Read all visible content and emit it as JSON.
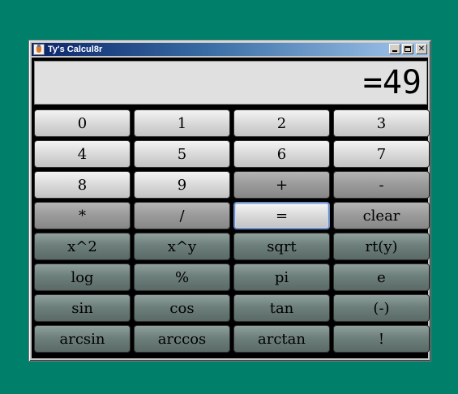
{
  "window": {
    "title": "Ty's Calcul8r"
  },
  "display": {
    "value": "=49"
  },
  "keys": [
    {
      "label": "0",
      "name": "key-0",
      "style": "light"
    },
    {
      "label": "1",
      "name": "key-1",
      "style": "light"
    },
    {
      "label": "2",
      "name": "key-2",
      "style": "light"
    },
    {
      "label": "3",
      "name": "key-3",
      "style": "light"
    },
    {
      "label": "4",
      "name": "key-4",
      "style": "light"
    },
    {
      "label": "5",
      "name": "key-5",
      "style": "light"
    },
    {
      "label": "6",
      "name": "key-6",
      "style": "light"
    },
    {
      "label": "7",
      "name": "key-7",
      "style": "light"
    },
    {
      "label": "8",
      "name": "key-8",
      "style": "light"
    },
    {
      "label": "9",
      "name": "key-9",
      "style": "light"
    },
    {
      "label": "+",
      "name": "key-plus",
      "style": "dark"
    },
    {
      "label": "-",
      "name": "key-minus",
      "style": "dark"
    },
    {
      "label": "*",
      "name": "key-multiply",
      "style": "dark"
    },
    {
      "label": "/",
      "name": "key-divide",
      "style": "dark"
    },
    {
      "label": "=",
      "name": "key-equals",
      "style": "light",
      "focused": true
    },
    {
      "label": "clear",
      "name": "key-clear",
      "style": "dark"
    },
    {
      "label": "x^2",
      "name": "key-square",
      "style": "slate"
    },
    {
      "label": "x^y",
      "name": "key-power",
      "style": "slate"
    },
    {
      "label": "sqrt",
      "name": "key-sqrt",
      "style": "slate"
    },
    {
      "label": "rt(y)",
      "name": "key-root",
      "style": "slate"
    },
    {
      "label": "log",
      "name": "key-log",
      "style": "slate"
    },
    {
      "label": "%",
      "name": "key-percent",
      "style": "slate"
    },
    {
      "label": "pi",
      "name": "key-pi",
      "style": "slate"
    },
    {
      "label": "e",
      "name": "key-e",
      "style": "slate"
    },
    {
      "label": "sin",
      "name": "key-sin",
      "style": "slate"
    },
    {
      "label": "cos",
      "name": "key-cos",
      "style": "slate"
    },
    {
      "label": "tan",
      "name": "key-tan",
      "style": "slate"
    },
    {
      "label": "(-)",
      "name": "key-negate",
      "style": "slate"
    },
    {
      "label": "arcsin",
      "name": "key-arcsin",
      "style": "slate"
    },
    {
      "label": "arccos",
      "name": "key-arccos",
      "style": "slate"
    },
    {
      "label": "arctan",
      "name": "key-arctan",
      "style": "slate"
    },
    {
      "label": "!",
      "name": "key-factorial",
      "style": "slate"
    }
  ]
}
